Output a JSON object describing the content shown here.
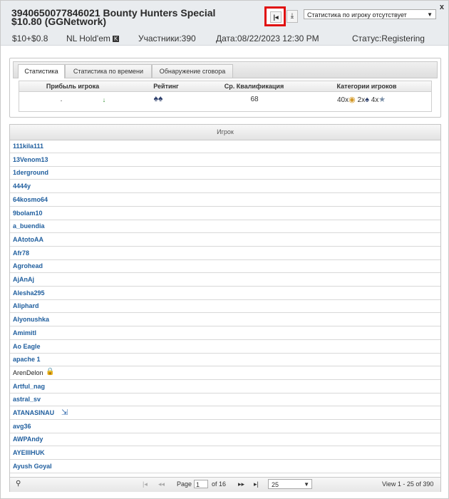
{
  "header": {
    "title": "394065007784602​1 Bounty Hunters Special $10.80 (GGNetwork)",
    "close": "x",
    "first_btn": "|◂",
    "download_btn": "⤓",
    "stat_select": "Статистика по игроку отсутствует",
    "buyin": "$10+$0.8",
    "game": "NL Hold'em",
    "game_badge": "K",
    "participants": "Участники:390",
    "date": "Дата:08/22/2023 12:30 PM",
    "status": "Статус:Registering"
  },
  "stats": {
    "tabs": [
      "Статистика",
      "Статистика по времени",
      "Обнаружение сговора"
    ],
    "columns": [
      "Прибыль игрока",
      "Рейтинг",
      "Ср. Квалификация",
      "Категории игроков"
    ],
    "profit": ".",
    "trend": "↓",
    "rating_icons": "♠♠",
    "avg_qualification": "68",
    "categories": [
      {
        "count": "40x",
        "icon": "fish-icon"
      },
      {
        "count": "2x",
        "icon": "shark-icon"
      },
      {
        "count": "4x",
        "icon": "star-icon"
      }
    ]
  },
  "players": {
    "header": "Игрок",
    "rows": [
      {
        "name": "111kila111"
      },
      {
        "name": "13Venom13"
      },
      {
        "name": "1derground"
      },
      {
        "name": "4444y"
      },
      {
        "name": "64kosmo64"
      },
      {
        "name": "9bolam10"
      },
      {
        "name": "a_buendia"
      },
      {
        "name": "AAtotoAA"
      },
      {
        "name": "Afr78"
      },
      {
        "name": "Agrohead"
      },
      {
        "name": "AjAnAj"
      },
      {
        "name": "Alesha295"
      },
      {
        "name": "Aliphard"
      },
      {
        "name": "Alyonushka"
      },
      {
        "name": "Amimitl"
      },
      {
        "name": "Ao Eagle"
      },
      {
        "name": "apache 1"
      },
      {
        "name": "ArenDelon",
        "icon": "lock-icon"
      },
      {
        "name": "Artful_nag"
      },
      {
        "name": "astral_sv"
      },
      {
        "name": "ATANASINAU",
        "icon": "export-icon"
      },
      {
        "name": "avg36"
      },
      {
        "name": "AWPAndy"
      },
      {
        "name": "AYEIIIHUK"
      },
      {
        "name": "Ayush Goyal"
      }
    ]
  },
  "pager": {
    "page_label": "Page",
    "page_value": "1",
    "of_label": "of 16",
    "per_page": "25",
    "view": "View 1 - 25 of 390"
  }
}
